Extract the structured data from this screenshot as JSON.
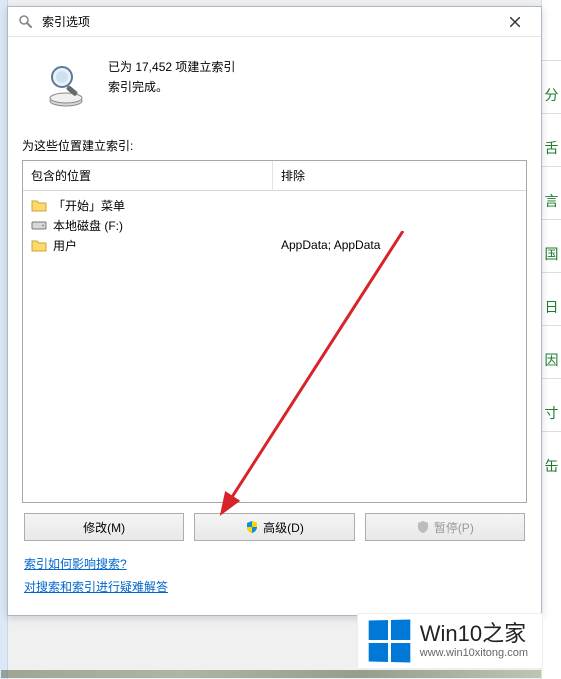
{
  "titlebar": {
    "title": "索引选项"
  },
  "status": {
    "count_line": "已为 17,452 项建立索引",
    "done_line": "索引完成。"
  },
  "section_label": "为这些位置建立索引:",
  "columns": {
    "included": "包含的位置",
    "excluded": "排除"
  },
  "locations": {
    "items": [
      {
        "icon": "folder",
        "label": "「开始」菜单",
        "exclude": ""
      },
      {
        "icon": "drive",
        "label": "本地磁盘 (F:)",
        "exclude": ""
      },
      {
        "icon": "folder",
        "label": "用户",
        "exclude": "AppData; AppData"
      }
    ]
  },
  "buttons": {
    "modify": "修改(M)",
    "advanced": "高级(D)",
    "pause": "暂停(P)"
  },
  "links": {
    "how_affects": "索引如何影响搜索?",
    "troubleshoot": "对搜索和索引进行疑难解答"
  },
  "watermark": {
    "title": "Win10之家",
    "url": "www.win10xitong.com"
  },
  "side_chars": [
    "分",
    "舌",
    "言",
    "国",
    "日",
    "因",
    "寸",
    "缶"
  ]
}
